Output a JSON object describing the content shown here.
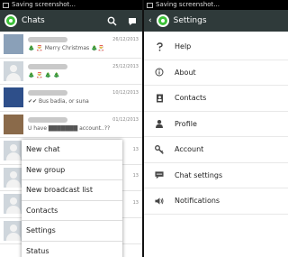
{
  "status_text": "Saving screenshot...",
  "left": {
    "title": "Chats",
    "chats": [
      {
        "avatar": "photo1",
        "time": "26/12/2013",
        "preview": "🎄 🎅 Merry Christmas 🎄🎅"
      },
      {
        "avatar": "generic",
        "time": "25/12/2013",
        "preview": "🎄 🎅 🎄 🎄"
      },
      {
        "avatar": "photo2",
        "time": "10/12/2013",
        "preview": "✔✔ Bus badia, or suna"
      },
      {
        "avatar": "photo3",
        "time": "01/12/2013",
        "preview": "U have ███████ account..??"
      },
      {
        "avatar": "generic",
        "time": "13",
        "preview": ""
      },
      {
        "avatar": "generic",
        "time": "13",
        "preview": ""
      },
      {
        "avatar": "generic",
        "time": "13",
        "preview": ""
      },
      {
        "avatar": "generic",
        "time": "",
        "preview": ""
      }
    ],
    "menu": [
      "New chat",
      "New group",
      "New broadcast list",
      "Contacts",
      "Settings",
      "Status"
    ]
  },
  "right": {
    "title": "Settings",
    "items": [
      {
        "label": "Help",
        "icon": "help-icon"
      },
      {
        "label": "About",
        "icon": "info-icon"
      },
      {
        "label": "Contacts",
        "icon": "contacts-icon"
      },
      {
        "label": "Profile",
        "icon": "profile-icon"
      },
      {
        "label": "Account",
        "icon": "key-icon"
      },
      {
        "label": "Chat settings",
        "icon": "chat-icon"
      },
      {
        "label": "Notifications",
        "icon": "speaker-icon"
      }
    ]
  }
}
